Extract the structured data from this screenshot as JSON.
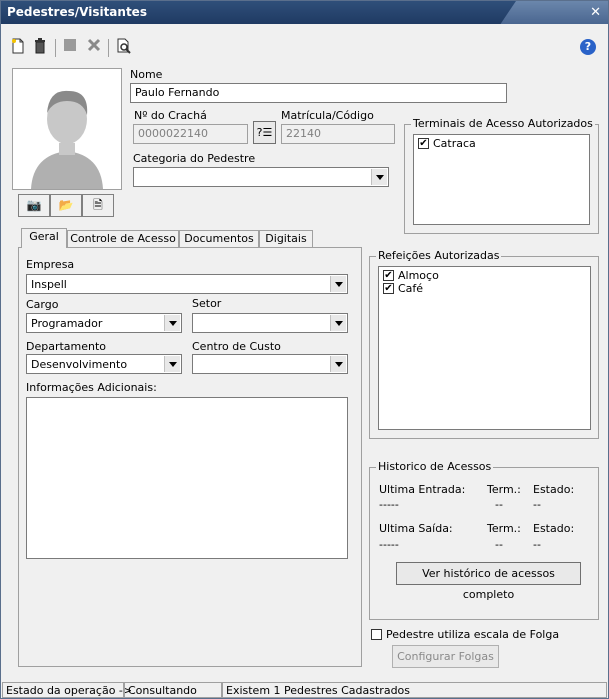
{
  "window": {
    "title": "Pedestres/Visitantes",
    "close_glyph": "✕"
  },
  "toolbar": {
    "icons": [
      "new-doc-icon",
      "delete-icon",
      "save-icon",
      "cancel-icon",
      "search-doc-icon"
    ],
    "help_glyph": "?"
  },
  "form": {
    "nome_label": "Nome",
    "nome_value": "Paulo Fernando",
    "cracha_label": "Nº do Crachá",
    "cracha_value": "0000022140",
    "matricula_label": "Matrícula/Código",
    "matricula_value": "22140",
    "categoria_label": "Categoria do Pedestre",
    "categoria_value": ""
  },
  "terminais": {
    "label": "Terminais de Acesso Autorizados",
    "items": [
      {
        "label": "Catraca",
        "checked": true
      }
    ]
  },
  "tabs": [
    {
      "label": "Geral",
      "active": true
    },
    {
      "label": "Controle de Acesso",
      "active": false
    },
    {
      "label": "Documentos",
      "active": false
    },
    {
      "label": "Digitais",
      "active": false
    }
  ],
  "geral": {
    "empresa_label": "Empresa",
    "empresa_value": "Inspell",
    "cargo_label": "Cargo",
    "cargo_value": "Programador",
    "setor_label": "Setor",
    "setor_value": "",
    "departamento_label": "Departamento",
    "departamento_value": "Desenvolvimento",
    "centro_label": "Centro de Custo",
    "centro_value": "",
    "info_label": "Informações Adicionais:",
    "info_value": ""
  },
  "refeicoes": {
    "label": "Refeições Autorizadas",
    "items": [
      {
        "label": "Almoço",
        "checked": true
      },
      {
        "label": "Café",
        "checked": true
      }
    ]
  },
  "historico": {
    "label": "Historico de Acessos",
    "entrada_label": "Ultima Entrada:",
    "saida_label": "Ultima Saída:",
    "term_label": "Term.:",
    "estado_label": "Estado:",
    "entrada_value": "-----",
    "entrada_term": "--",
    "entrada_estado": "--",
    "saida_value": "-----",
    "saida_term": "--",
    "saida_estado": "--",
    "button": "Ver histórico de acessos completo"
  },
  "folga": {
    "checkbox_label": "Pedestre utiliza escala de Folga",
    "checked": false,
    "button": "Configurar Folgas"
  },
  "statusbar": {
    "estado_label": "Estado da operação ->",
    "estado_value": "Consultando",
    "count_text": "Existem 1 Pedestres Cadastrados"
  }
}
